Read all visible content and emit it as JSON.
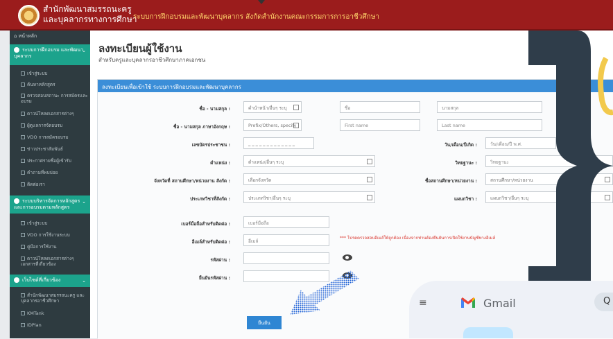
{
  "header": {
    "org_line1": "สำนักพัฒนาสมรรถนะครู",
    "org_line2": "และบุคลากรทางการศึกษา",
    "system_title": "ระบบการฝึกอบรมและพัฒนาบุคลากร สังกัดสำนักงานคณะกรรมการการอาชีวศึกษา"
  },
  "sidebar": {
    "home": "หน้าหลัก",
    "sections": [
      {
        "label": "ระบบการฝึกอบรม และพัฒนาบุคลากร",
        "items": [
          "เข้าสู่ระบบ",
          "ค้นหาหลักสูตร",
          "ตรวจสอบสถานะ การสมัครและอบรม",
          "ดาวน์โหลดเอกสารต่างๆ",
          "ผู้ดูแลการจัดอบรม",
          "VDO การสมัครอบรม",
          "ข่าวประชาสัมพันธ์",
          "ประกาศรายชื่อผู้เข้ารับ",
          "คำถามที่พบบ่อย",
          "ติดต่อเรา"
        ]
      },
      {
        "label": "ระบบบริหารจัดการหลักสูตร และการอบรมตามหลักสูตร",
        "items": [
          "เข้าสู่ระบบ",
          "VDO การใช้งานระบบ",
          "คู่มือการใช้งาน",
          "ดาวน์โหลดเอกสารต่างๆ เอกสารที่เกี่ยวข้อง"
        ]
      },
      {
        "label": "เว็บไซต์ที่เกี่ยวข้อง",
        "items": [
          "สำนักพัฒนาสมรรถนะครู และบุคลากรอาชีวศึกษา",
          "KMTank",
          "IDPlan"
        ]
      }
    ]
  },
  "page": {
    "title": "ลงทะเบียนผู้ใช้งาน",
    "subtitle": "สำหรับครูและบุคลากรอาชีวศึกษาภาคเอกชน",
    "panel_title": "ลงทะเบียนเพื่อเข้าใช้ ระบบการฝึกอบรมและพัฒนาบุคลากร"
  },
  "form": {
    "name_th_label": "ชื่อ - นามสกุล :",
    "prefix_th_value": "คำนำหน้า/อื่นๆ ระบุ",
    "firstname_th_placeholder": "ชื่อ",
    "lastname_th_placeholder": "นามสกุล",
    "name_en_label": "ชื่อ - นามสกุล ภาษาอังกฤษ :",
    "prefix_en_value": "Prefix/Others, specify",
    "firstname_en_placeholder": "First name",
    "lastname_en_placeholder": "Last name",
    "idcard_label": "เลขบัตรประชาชน :",
    "idcard_placeholder": "_ _ _ _ _ _ _ _ _ _ _ _ _",
    "dob_label": "วัน/เดือน/ปีเกิด :",
    "dob_placeholder": "วัน/เดือน/ปี พ.ศ.",
    "position_label": "ตำแหน่ง :",
    "position_value": "ตำแหน่ง/อื่นๆ ระบุ",
    "academic_label": "วิทยฐานะ :",
    "academic_value": "วิทยฐานะ",
    "province_label": "จังหวัดที่ สถานศึกษา/หน่วยงาน สังกัด :",
    "province_value": "เลือกจังหวัด",
    "school_label": "ชื่อสถานศึกษา/หน่วยงาน :",
    "school_value": "สถานศึกษา/หน่วยงาน",
    "type_label": "ประเภทวิชาที่สังกัด :",
    "type_value": "ประเภทวิชา/อื่นๆ ระบุ",
    "dept_label": "แผนกวิชา :",
    "dept_value": "แผนกวิชา/อื่นๆ ระบุ",
    "phone_label": "เบอร์มือถือสำหรับติดต่อ :",
    "phone_placeholder": "เบอร์มือถือ",
    "email_label": "อีเมล์สำหรับติดต่อ :",
    "email_placeholder": "อีเมล์",
    "email_note": "*** โปรดตรวจสอบอีเมล์ให้ถูกต้อง เนื่องจากท่านต้องยืนยันการเปิดใช้งานบัญชีทางอีเมล์",
    "password_label": "รหัสผ่าน :",
    "confirm_label": "ยืนยันรหัสผ่าน :",
    "submit_label": "ยืนยัน"
  },
  "gmail": {
    "label": "Gmail",
    "menu_glyph": "≡",
    "search_glyph": "Q"
  },
  "colors": {
    "header_red": "#9b1c1c",
    "sidebar_dark": "#2e3b40",
    "sidebar_teal": "#1ca38c",
    "panel_blue": "#3b8ed8",
    "note_red": "#d9332b"
  }
}
